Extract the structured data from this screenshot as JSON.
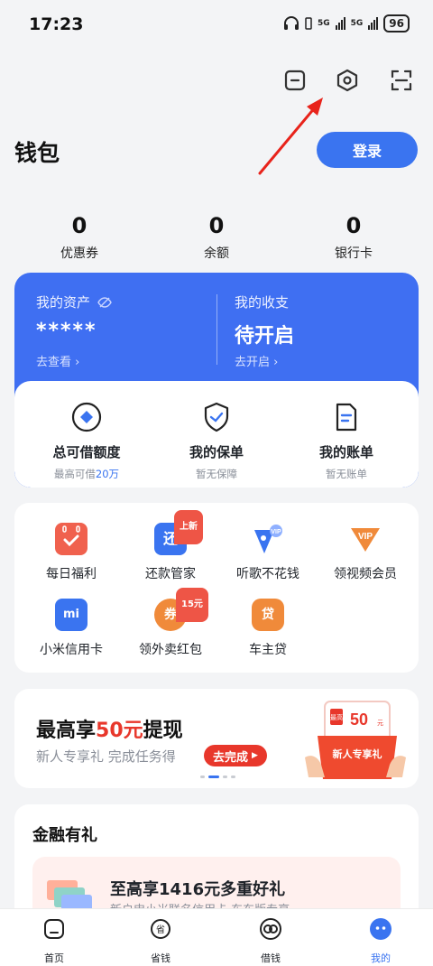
{
  "status": {
    "time": "17:23",
    "net1": "5G",
    "net2": "5G",
    "battery": "96"
  },
  "header": {
    "title": "钱包",
    "login_label": "登录",
    "toolbar_icons": [
      "message-icon",
      "settings-hexagon-icon",
      "scan-icon"
    ]
  },
  "stats": [
    {
      "value": "0",
      "label": "优惠券"
    },
    {
      "value": "0",
      "label": "余额"
    },
    {
      "value": "0",
      "label": "银行卡"
    }
  ],
  "assets": {
    "left_label": "我的资产",
    "left_value": "*****",
    "left_link": "去查看 ›",
    "right_label": "我的收支",
    "right_value": "待开启",
    "right_link": "去开启 ›"
  },
  "quick_actions": [
    {
      "title": "总可借额度",
      "sub_prefix": "最高可借",
      "sub_highlight": "20万"
    },
    {
      "title": "我的保单",
      "sub": "暂无保障"
    },
    {
      "title": "我的账单",
      "sub": "暂无账单"
    }
  ],
  "services": [
    {
      "label": "每日福利",
      "icon": "calendar-check-icon"
    },
    {
      "label": "还款管家",
      "icon": "repay-icon",
      "icon_text": "还",
      "tag": "上新"
    },
    {
      "label": "听歌不花钱",
      "icon": "music-vip-icon"
    },
    {
      "label": "领视频会员",
      "icon": "vip-icon",
      "icon_text": "VIP"
    },
    {
      "label": "小米信用卡",
      "icon": "mi-card-icon",
      "icon_text": "mi"
    },
    {
      "label": "领外卖红包",
      "icon": "coupon-icon",
      "icon_text": "券",
      "tag": "15元"
    },
    {
      "label": "车主贷",
      "icon": "car-loan-icon",
      "icon_text": "贷"
    }
  ],
  "promo": {
    "title_prefix": "最高享",
    "title_highlight": "50元",
    "title_suffix": "提现",
    "subtitle": "新人专享礼 完成任务得",
    "button": "去完成",
    "art_amount": "50",
    "art_unit": "元",
    "art_badge": "最高",
    "art_caption": "新人专享礼"
  },
  "finance": {
    "title": "金融有礼",
    "card_title": "至高享1416元多重好礼",
    "card_sub": "新户申小米联名信用卡·东东版专享"
  },
  "tabs": [
    {
      "label": "首页",
      "icon": "home-icon"
    },
    {
      "label": "省钱",
      "icon": "save-money-icon"
    },
    {
      "label": "借钱",
      "icon": "borrow-icon"
    },
    {
      "label": "我的",
      "icon": "profile-icon",
      "active": true
    }
  ],
  "colors": {
    "primary": "#3a74f0",
    "accent_red": "#e8372b",
    "background": "#f3f4f6"
  }
}
